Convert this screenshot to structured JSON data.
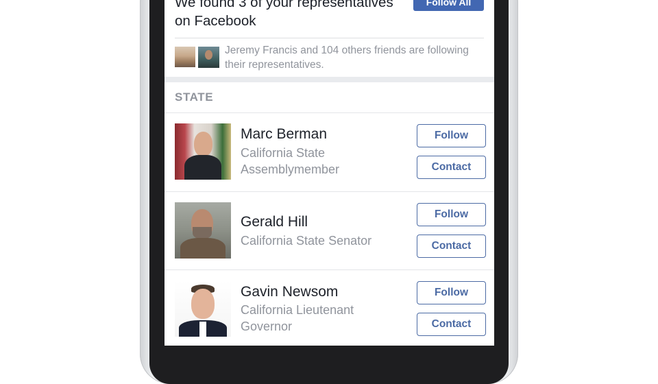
{
  "header": {
    "found_text": "We found 3 of your representatives on Facebook",
    "follow_all_label": "Follow All"
  },
  "friends": {
    "text": "Jeremy Francis and 104 others friends are following their representatives."
  },
  "section": {
    "title": "STATE"
  },
  "representatives": [
    {
      "name": "Marc Berman",
      "title": "California State Assemblymember",
      "follow_label": "Follow",
      "contact_label": "Contact"
    },
    {
      "name": "Gerald Hill",
      "title": "California State Senator",
      "follow_label": "Follow",
      "contact_label": "Contact"
    },
    {
      "name": "Gavin Newsom",
      "title": "California Lieutenant Governor",
      "follow_label": "Follow",
      "contact_label": "Contact"
    }
  ],
  "colors": {
    "accent": "#4267b2",
    "button_border": "#4b6aa4",
    "secondary_text": "#90949c",
    "primary_text": "#1d2129"
  }
}
